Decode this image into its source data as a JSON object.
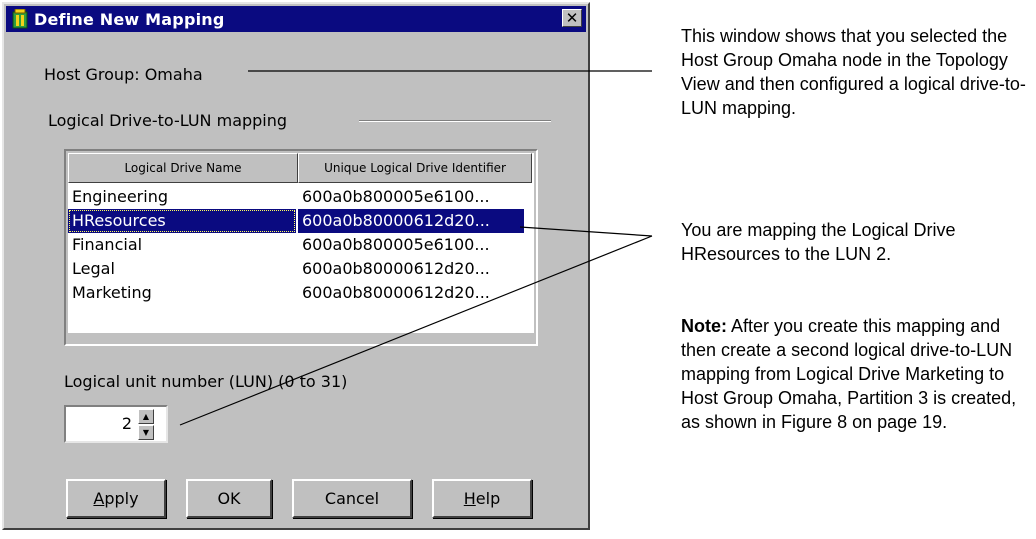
{
  "dialog": {
    "title": "Define New Mapping",
    "close_label": "✕",
    "host_group_label": "Host Group: Omaha",
    "group_label": "Logical Drive-to-LUN mapping",
    "table": {
      "columns": [
        "Logical Drive Name",
        "Unique Logical Drive Identifier"
      ],
      "rows": [
        {
          "name": "Engineering",
          "id": "600a0b800005e6100..."
        },
        {
          "name": "HResources",
          "id": "600a0b80000612d20..."
        },
        {
          "name": "Financial",
          "id": "600a0b800005e6100..."
        },
        {
          "name": "Legal",
          "id": "600a0b80000612d20..."
        },
        {
          "name": "Marketing",
          "id": "600a0b80000612d20..."
        }
      ],
      "selected_index": 1
    },
    "lun_label": "Logical unit number (LUN) (0 to 31)",
    "lun_value": "2",
    "buttons": {
      "apply_rest": "pply",
      "apply_mnemonic": "A",
      "ok": "OK",
      "cancel": "Cancel",
      "help_rest": "elp",
      "help_mnemonic": "H"
    }
  },
  "annotations": {
    "note1": "This window shows that you selected the Host Group Omaha node in the Topology View and then configured a logical drive-to-LUN mapping.",
    "note2": "You are mapping the Logical Drive HResources to the LUN 2.",
    "note3_bold": "Note:",
    "note3_text": " After you create this mapping and then create a second logical drive-to-LUN mapping from Logical Drive Marketing to Host Group Omaha, Partition 3 is created, as shown in Figure 8 on page 19."
  },
  "colors": {
    "title_bar": "#0a0a80",
    "dialog_bg": "#c0c0c0",
    "selection": "#0a0a80"
  }
}
